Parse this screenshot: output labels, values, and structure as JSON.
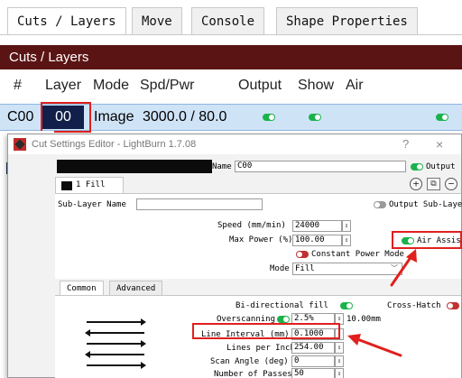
{
  "tabs": [
    "Cuts / Layers",
    "Move",
    "Console",
    "Shape Properties"
  ],
  "panel": {
    "title": "Cuts / Layers",
    "columns": [
      "#",
      "Layer",
      "Mode",
      "Spd/Pwr",
      "Output",
      "Show",
      "Air"
    ],
    "row": {
      "id": "C00",
      "layer": "00",
      "mode": "Image",
      "spdpwr": "3000.0 / 80.0"
    }
  },
  "behind": {
    "swatch": "00"
  },
  "dialog": {
    "title": "Cut Settings Editor - LightBurn 1.7.08",
    "help": "?",
    "close": "×",
    "name_label": "Name",
    "name_value": "C00",
    "output_label": "Output",
    "sublayer_tab": "1 Fill",
    "sublayer_name_label": "Sub-Layer Name",
    "output_sublayer_label": "Output Sub-Layer",
    "speed_label": "Speed (mm/min)",
    "speed_value": "24000",
    "maxpower_label": "Max Power (%)",
    "maxpower_value": "100.00",
    "air_assist_label": "Air Assist",
    "constant_power_label": "Constant Power Mode",
    "mode_label": "Mode",
    "mode_value": "Fill",
    "mode_tabs": [
      "Common",
      "Advanced"
    ],
    "bidir_label": "Bi-directional fill",
    "crosshatch_label": "Cross-Hatch",
    "overscan_label": "Overscanning",
    "overscan_value": "2.5%",
    "overscan_mm": "10.00mm",
    "line_interval_label": "Line Interval (mm)",
    "line_interval_value": "0.1000",
    "lpi_label": "Lines per Inch",
    "lpi_value": "254.00",
    "scan_angle_label": "Scan Angle (deg)",
    "scan_angle_value": "0",
    "passes_label": "Number of Passes",
    "passes_value": "50"
  },
  "colors": {
    "accent_red": "#e0201e",
    "panel_title_bg": "#5b1414",
    "toggle_on": "#1ab34a",
    "row_selected": "#cfe3f7"
  }
}
